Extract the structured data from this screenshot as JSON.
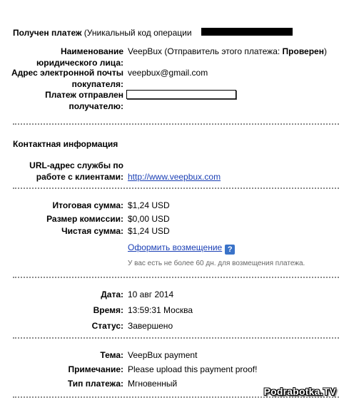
{
  "header": {
    "received_bold": "Получен платеж",
    "received_rest": " (Уникальный код операции"
  },
  "sender": {
    "name_label": "Наименование юридического лица:",
    "name_value_prefix": "VeepBux (Отправитель этого платежа: ",
    "name_value_status": "Проверен",
    "name_value_suffix": ")",
    "email_label": "Адрес электронной почты покупателя:",
    "email_value": "veepbux@gmail.com",
    "sent_to_label": "Платеж отправлен получателю:"
  },
  "contact": {
    "title": "Контактная информация",
    "url_label": "URL-адрес службы по работе с клиентами:",
    "url_value": "http://www.veepbux.com"
  },
  "amounts": {
    "total_label": "Итоговая сумма:",
    "total_value": "$1,24 USD",
    "fee_label": "Размер комиссии:",
    "fee_value": "$0,00 USD",
    "net_label": "Чистая сумма:",
    "net_value": "$1,24 USD",
    "refund_link": "Оформить возмещение",
    "refund_help": "?",
    "refund_note": "У вас есть не более 60 дн. для возмещения платежа."
  },
  "details": {
    "date_label": "Дата:",
    "date_value": "10 авг 2014",
    "time_label": "Время:",
    "time_value": "13:59:31 Москва",
    "status_label": "Статус:",
    "status_value": "Завершено"
  },
  "misc": {
    "subject_label": "Тема:",
    "subject_value": "VeepBux payment",
    "note_label": "Примечание:",
    "note_value": "Please upload this payment proof!",
    "type_label": "Тип платежа:",
    "type_value": "Мгновенный"
  },
  "watermark": "Podrabotka.TV"
}
